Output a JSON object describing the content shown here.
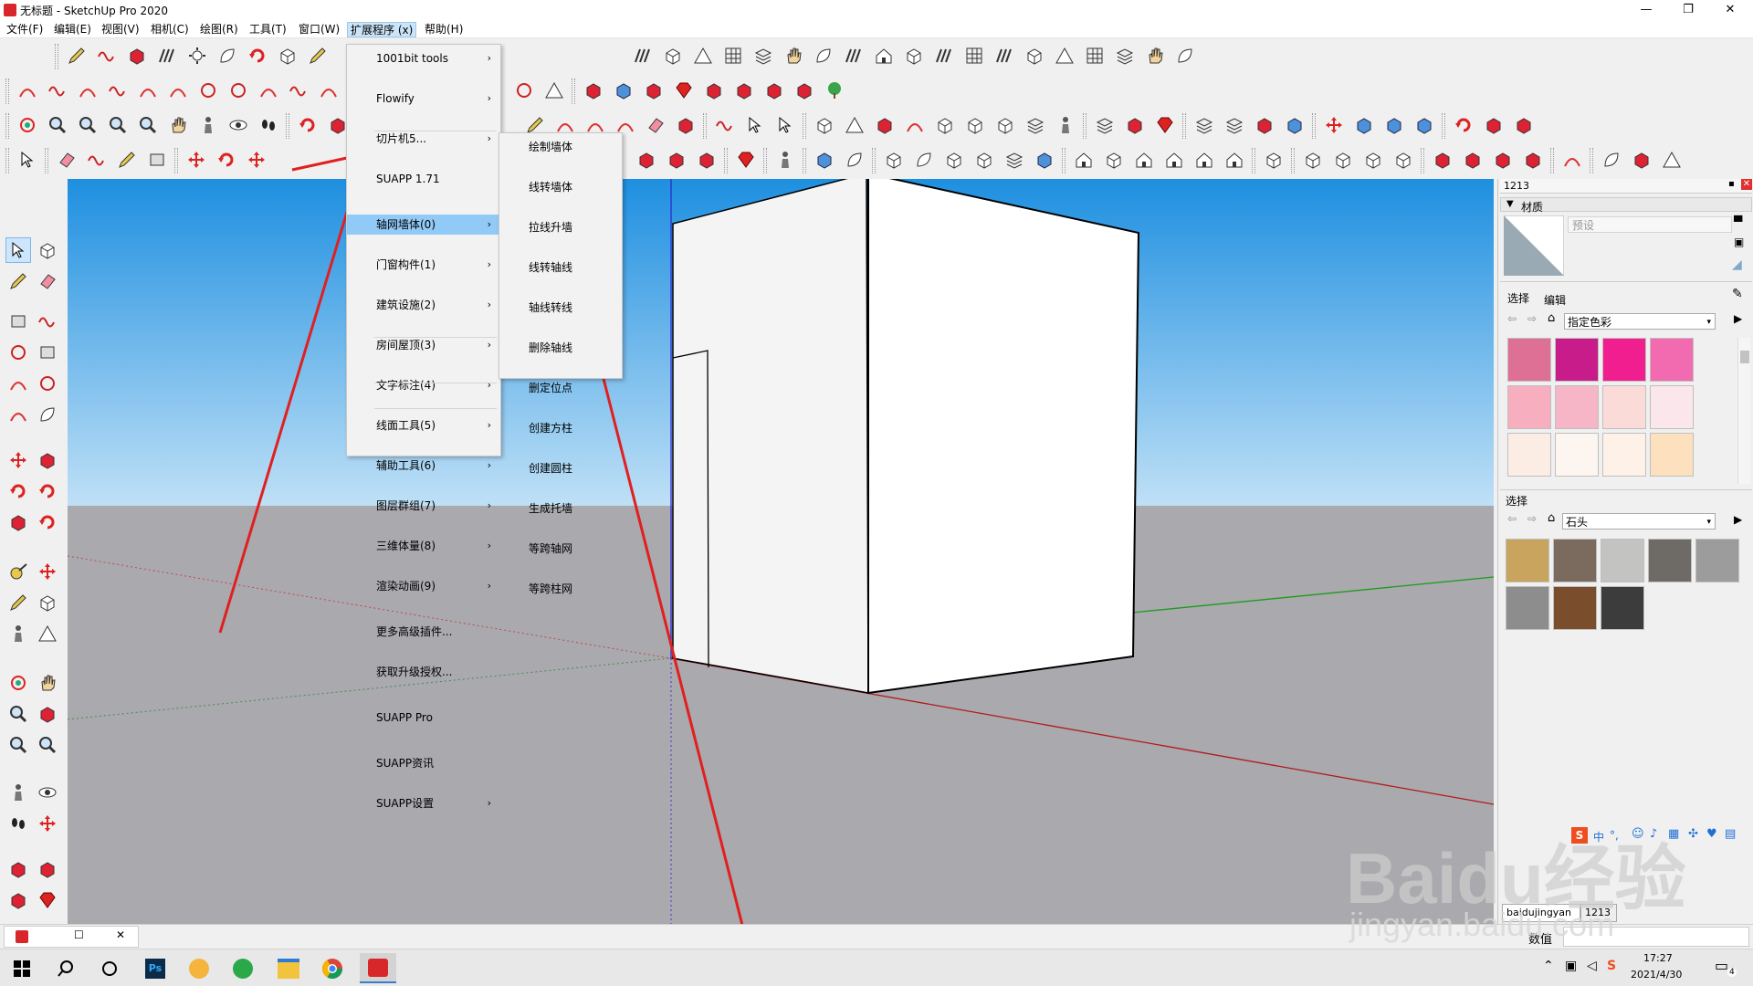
{
  "window": {
    "title": "无标题 - SketchUp Pro 2020",
    "controls": [
      "—",
      "❐",
      "✕"
    ]
  },
  "menubar": {
    "items": [
      {
        "label": "文件(F)"
      },
      {
        "label": "编辑(E)"
      },
      {
        "label": "视图(V)"
      },
      {
        "label": "相机(C)"
      },
      {
        "label": "绘图(R)"
      },
      {
        "label": "工具(T)"
      },
      {
        "label": "窗口(W)"
      },
      {
        "label": "扩展程序 (x)"
      },
      {
        "label": "帮助(H)"
      }
    ],
    "active_index": 7
  },
  "extensions_menu": {
    "items": [
      {
        "label": "1001bit tools",
        "submenu": true
      },
      {
        "label": "Flowify",
        "submenu": true
      },
      {
        "label": "切片机5...",
        "submenu": true
      },
      {
        "label": "SUAPP 1.71",
        "submenu": false
      },
      {
        "label": "轴网墙体(0)",
        "submenu": true
      },
      {
        "label": "门窗构件(1)",
        "submenu": true
      },
      {
        "label": "建筑设施(2)",
        "submenu": true
      },
      {
        "label": "房间屋顶(3)",
        "submenu": true
      },
      {
        "label": "文字标注(4)",
        "submenu": true
      },
      {
        "label": "线面工具(5)",
        "submenu": true
      },
      {
        "label": "辅助工具(6)",
        "submenu": true
      },
      {
        "label": "图层群组(7)",
        "submenu": true
      },
      {
        "label": "三维体量(8)",
        "submenu": true
      },
      {
        "label": "渲染动画(9)",
        "submenu": true
      },
      {
        "label": "更多高级插件...",
        "submenu": false
      },
      {
        "label": "获取升级授权...",
        "submenu": false
      },
      {
        "label": "SUAPP Pro",
        "submenu": false
      },
      {
        "label": "SUAPP资讯",
        "submenu": false
      },
      {
        "label": "SUAPP设置",
        "submenu": true
      }
    ],
    "highlighted": "轴网墙体(0)"
  },
  "grid_wall_submenu": {
    "items": [
      "绘制墙体",
      "线转墙体",
      "拉线升墙",
      "线转轴线",
      "轴线转线",
      "删除轴线",
      "删定位点",
      "创建方柱",
      "创建圆柱",
      "生成托墙",
      "等跨轴网",
      "等跨柱网"
    ]
  },
  "tray": {
    "panel_title": "1213",
    "section": "材质",
    "material_name_placeholder": "预设",
    "tab_select": "选择",
    "tab_edit": "编辑",
    "library_top": "指定色彩",
    "select_label": "选择",
    "library_bottom": "石头",
    "color_swatches": [
      "#de6f95",
      "#c81c8a",
      "#f01e8f",
      "#f26bb0",
      "#f7aebf",
      "#f6b6c8",
      "#fbdbd8",
      "#fbe6ec",
      "#fbede3",
      "#fdf5ef",
      "#fdf1e8",
      "#fde0bd"
    ],
    "stone_swatches": [
      "#c8a45e",
      "#7b6b5e",
      "#c3c3c1",
      "#6e6b67",
      "#9c9c9c",
      "#8d8d8d",
      "#7a4e2c",
      "#3c3c3c"
    ],
    "bottom_tabs": [
      "baidujingyan",
      "1213"
    ],
    "numeric_label": "数值"
  },
  "taskbar": {
    "time": "17:27",
    "date": "2021/4/30",
    "notification_count": "4",
    "ime_items": [
      "中",
      "°,"
    ]
  },
  "watermark": {
    "line1": "Baidu经验",
    "line2": "jingyan.baidu.com"
  },
  "colors": {
    "menu_highlight": "#91c9f7",
    "arrow_red": "#e02020",
    "sky_top": "#1e8fe0",
    "ground": "#a9a9ae"
  }
}
